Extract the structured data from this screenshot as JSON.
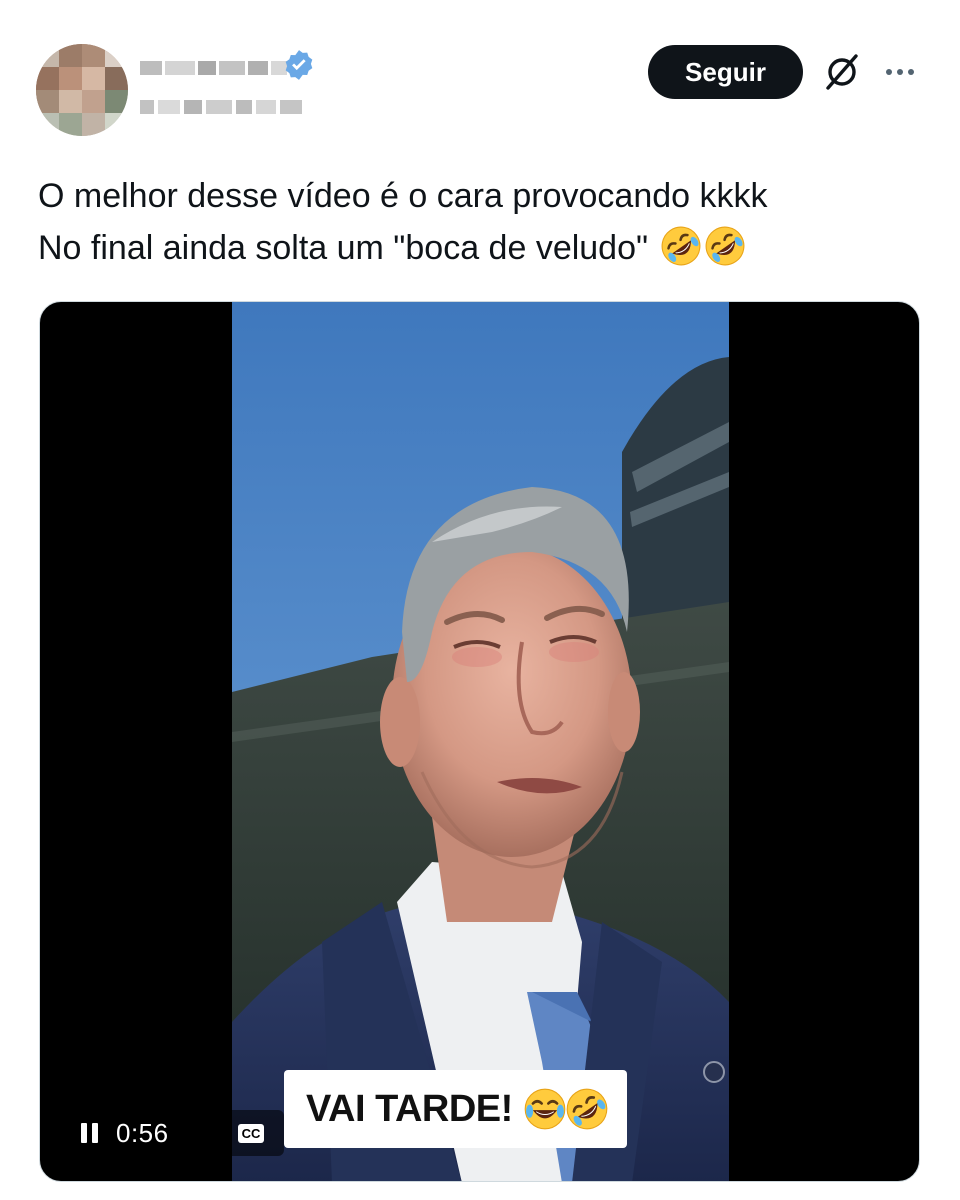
{
  "header": {
    "follow_label": "Seguir",
    "icons": [
      "verified-badge-icon",
      "grok-icon",
      "more-options-icon"
    ]
  },
  "tweet": {
    "text_line1": "O melhor desse vídeo é o cara provocando kkkk",
    "text_line2": "No final ainda solta um \"boca de veludo\"",
    "emojis": [
      "rolling-on-floor-laughing",
      "rolling-on-floor-laughing"
    ]
  },
  "video": {
    "caption_text": "VAI TARDE!",
    "caption_emojis": [
      "face-with-tears-of-joy",
      "rolling-on-floor-laughing"
    ],
    "time": "0:56",
    "cc_label": "CC",
    "state": "playing"
  },
  "colors": {
    "follow_bg": "#0f1419",
    "text": "#0f1419",
    "verified": "#1d9bf0",
    "muted": "#536471"
  }
}
